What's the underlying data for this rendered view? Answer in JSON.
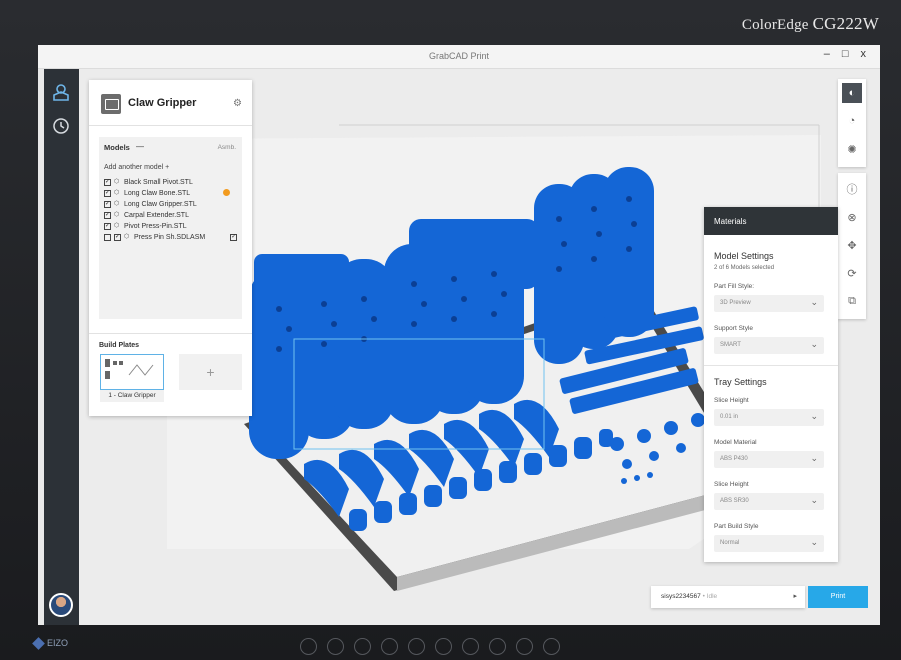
{
  "monitor": {
    "brand_prefix": "ColorEdge",
    "brand_model": "CG222W",
    "bezel_logo": "EIZO"
  },
  "window": {
    "title": "GrabCAD Print",
    "minimize": "–",
    "maximize": "□",
    "close": "x"
  },
  "project": {
    "name": "Claw Gripper",
    "models_header": "Models",
    "models_dash": "—",
    "assembly_label": "Asmb.",
    "add_model": "Add another model",
    "add_icon": "+",
    "models": [
      {
        "name": "Black Small Pivot.STL"
      },
      {
        "name": "Long Claw Bone.STL"
      },
      {
        "name": "Long Claw Gripper.STL"
      },
      {
        "name": "Carpal Extender.STL"
      },
      {
        "name": "Pivot Press-Pin.STL"
      },
      {
        "name": "Press Pin Sh.SDLASM"
      }
    ],
    "build_plates_title": "Build Plates",
    "build_plates": [
      {
        "label": "1 - Claw Gripper"
      }
    ],
    "add_plate": "+"
  },
  "materials": {
    "title": "Materials",
    "model_settings_title": "Model Settings",
    "selection_count": "2 of 6 Models selected",
    "part_fill_label": "Part Fill Style:",
    "part_fill_value": "3D Preview",
    "support_label": "Support Style",
    "support_value": "SMART",
    "tray_title": "Tray Settings",
    "slice_height_label": "Slice Height",
    "slice_height_value": "0.01 in",
    "model_material_label": "Model Material",
    "model_material_value": "ABS P430",
    "slice_height2_label": "Slice Height",
    "slice_height2_value": "ABS SR30",
    "build_style_label": "Part Build Style",
    "build_style_value": "Normal"
  },
  "printer": {
    "id": "sisys2234567",
    "separator": "•",
    "status": "Idle",
    "arrow": "▸"
  },
  "print_button": "Print",
  "icons": [
    "user-cube-icon",
    "history-clock-icon",
    "view-cube-icon",
    "orbit-icon",
    "mesh-icon",
    "info-icon",
    "material-icon",
    "move-icon",
    "rotate-icon",
    "scale-icon"
  ],
  "colors": {
    "model_blue": "#1466d6",
    "accent": "#27a8e8",
    "rail": "#2c3137"
  }
}
